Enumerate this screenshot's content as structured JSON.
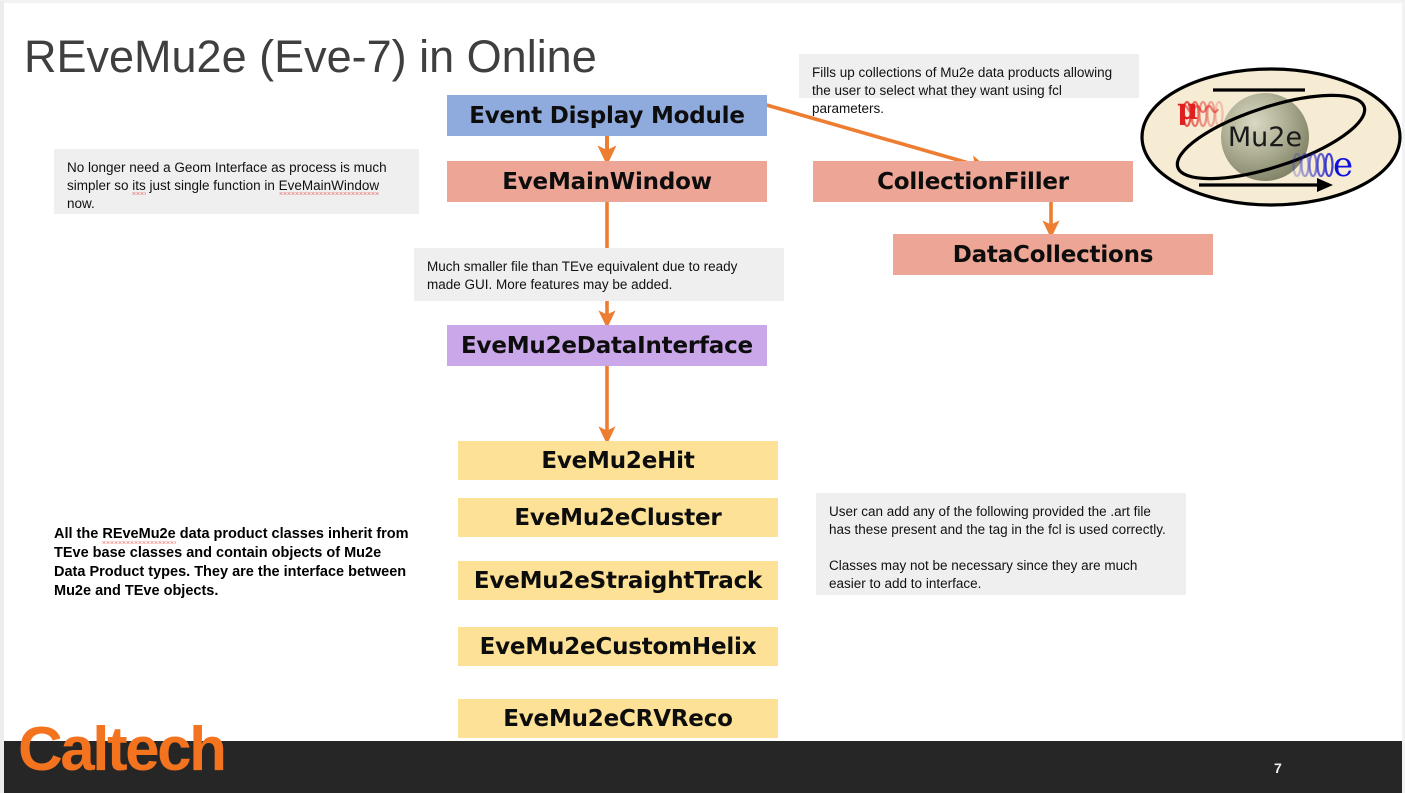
{
  "slide": {
    "title": "REveMu2e (Eve-7) in Online",
    "page_number": "7",
    "footer_logo": "Caltech",
    "colors": {
      "blue_box": "#8FAADC",
      "salmon_box": "#EDA595",
      "purple_box": "#CAA7E9",
      "yellow_box": "#FCE196",
      "arrow": "#ED7D31",
      "note_background": "#EFEFEF",
      "footer_bar": "#262626",
      "caltech_orange": "#F4731F",
      "title_text": "#3F3F3F"
    }
  },
  "flow": {
    "boxes": [
      {
        "id": "event-display-module",
        "label": "Event Display Module",
        "color": "blue"
      },
      {
        "id": "eve-main-window",
        "label": "EveMainWindow",
        "color": "salmon"
      },
      {
        "id": "collection-filler",
        "label": "CollectionFiller",
        "color": "salmon"
      },
      {
        "id": "data-collections",
        "label": "DataCollections",
        "color": "salmon"
      },
      {
        "id": "eve-mu2e-data-interface",
        "label": "EveMu2eDataInterface",
        "color": "purple"
      },
      {
        "id": "eve-mu2e-hit",
        "label": "EveMu2eHit",
        "color": "yellow"
      },
      {
        "id": "eve-mu2e-cluster",
        "label": "EveMu2eCluster",
        "color": "yellow"
      },
      {
        "id": "eve-mu2e-straight-track",
        "label": "EveMu2eStraightTrack",
        "color": "yellow"
      },
      {
        "id": "eve-mu2e-custom-helix",
        "label": "EveMu2eCustomHelix",
        "color": "yellow"
      },
      {
        "id": "eve-mu2e-crv-reco",
        "label": "EveMu2eCRVReco",
        "color": "yellow"
      }
    ],
    "connections": [
      {
        "from": "event-display-module",
        "to": "eve-main-window",
        "style": "vertical"
      },
      {
        "from": "event-display-module",
        "to": "collection-filler",
        "style": "diagonal"
      },
      {
        "from": "eve-main-window",
        "to": "eve-mu2e-data-interface",
        "style": "vertical"
      },
      {
        "from": "collection-filler",
        "to": "data-collections",
        "style": "vertical"
      },
      {
        "from": "eve-mu2e-data-interface",
        "to": "eve-mu2e-hit",
        "style": "vertical"
      }
    ]
  },
  "notes": {
    "collection_filler": "Fills up collections of Mu2e data products allowing the user to select what they want using fcl parameters.",
    "geom_interface": {
      "part1": "No longer need a Geom Interface as process is much simpler so ",
      "misspelled1": "its",
      "part2": " just single function in ",
      "misspelled2": "EveMainWindow",
      "part3": " now."
    },
    "smaller_file": "Much smaller file than TEve equivalent due to ready made GUI. More features may be added.",
    "data_products": {
      "part1": "All the ",
      "misspelled1": "REveMu2e",
      "part2": " data product classes inherit from TEve base classes and contain objects of Mu2e Data Product types. They are the interface between Mu2e and TEve objects."
    },
    "user_can_add": {
      "paragraph1": "User can add any of the following provided the .art file has these present and the tag in the fcl is used correctly.",
      "paragraph2": "Classes may not be necessary since they are much easier to add to interface."
    }
  },
  "logo": {
    "name": "mu2e-experiment-logo",
    "sphere_label": "Mu2e",
    "muon_symbol": "μ",
    "electron_symbol": "e"
  }
}
